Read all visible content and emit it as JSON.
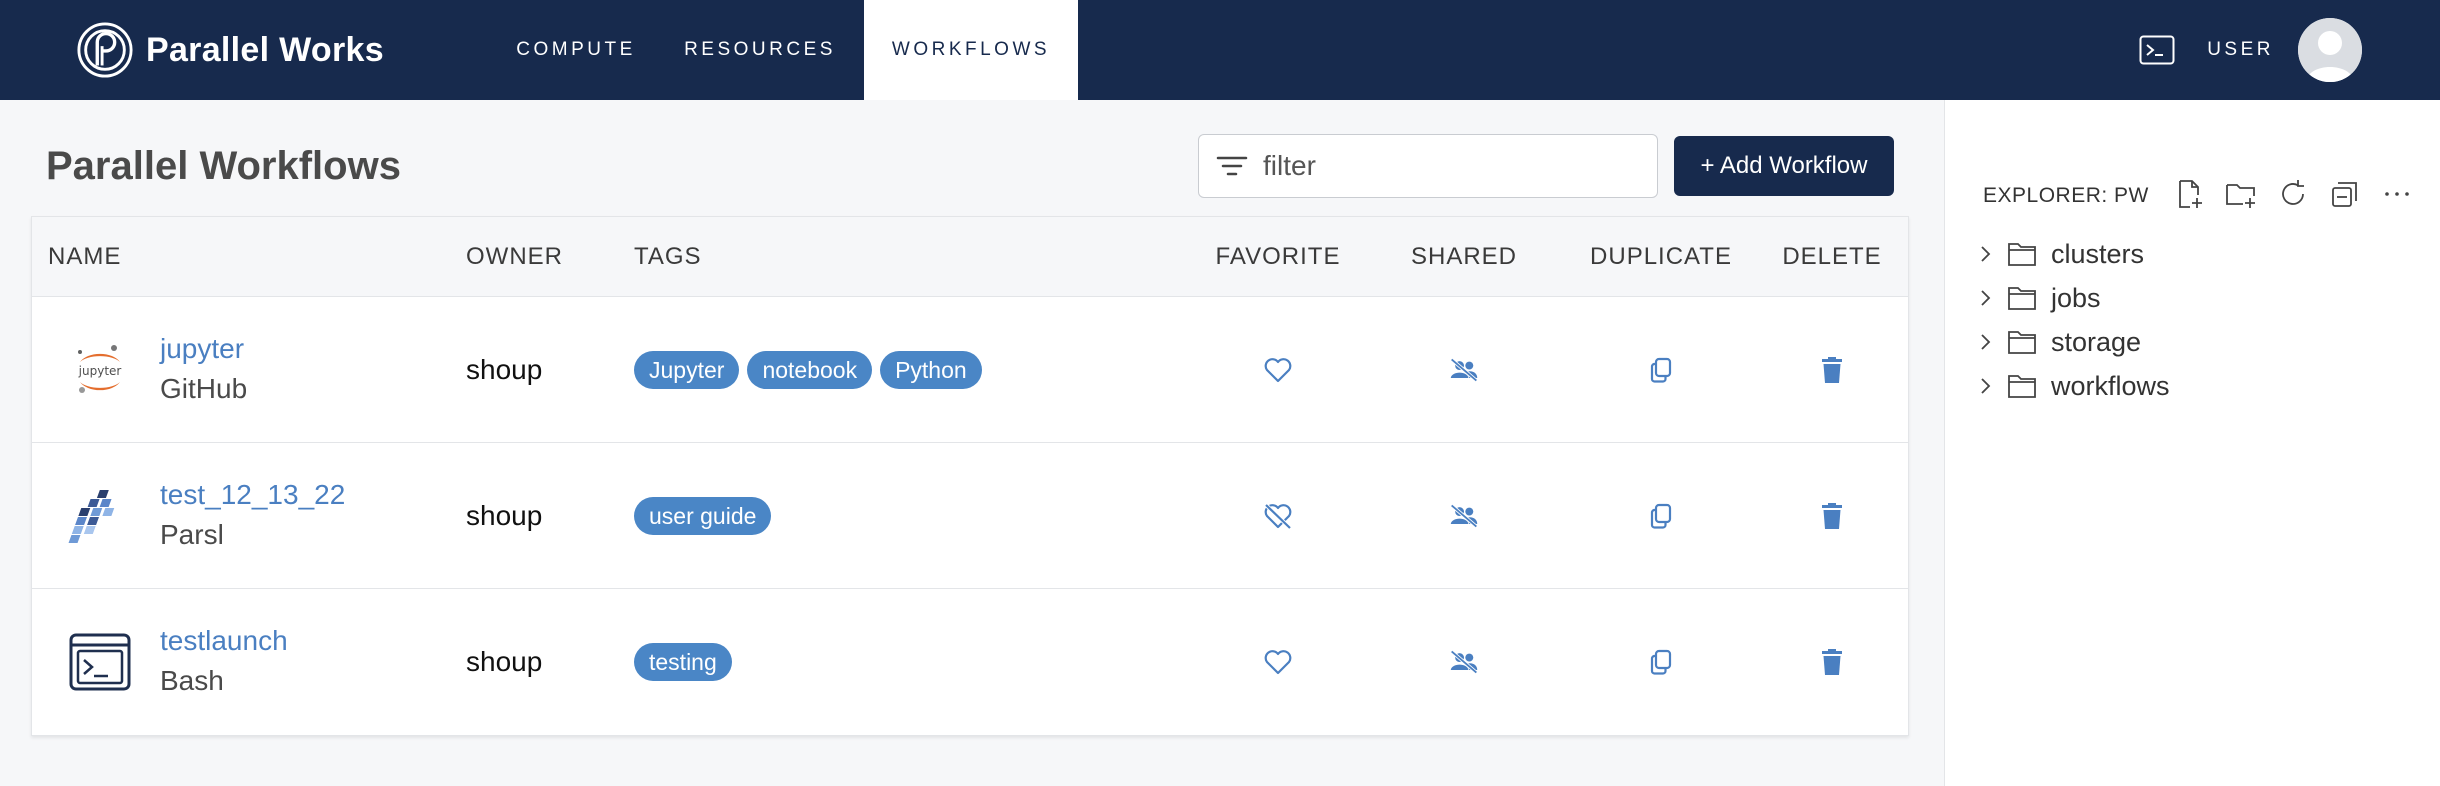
{
  "brand": {
    "name": "Parallel Works"
  },
  "nav": {
    "items": [
      {
        "label": "COMPUTE"
      },
      {
        "label": "RESOURCES"
      },
      {
        "label": "WORKFLOWS"
      }
    ],
    "user_label": "USER"
  },
  "page": {
    "title": "Parallel Workflows",
    "filter_placeholder": "filter",
    "add_button": "+ Add Workflow"
  },
  "table": {
    "columns": [
      "NAME",
      "OWNER",
      "TAGS",
      "FAVORITE",
      "SHARED",
      "DUPLICATE",
      "DELETE"
    ],
    "rows": [
      {
        "name": "jupyter",
        "source": "GitHub",
        "owner": "shoup",
        "tags": [
          "Jupyter",
          "notebook",
          "Python"
        ],
        "logo": "jupyter-logo",
        "favorite": "heart-icon"
      },
      {
        "name": "test_12_13_22",
        "source": "Parsl",
        "owner": "shoup",
        "tags": [
          "user guide"
        ],
        "logo": "parsl-logo",
        "favorite": "heart-off-icon"
      },
      {
        "name": "testlaunch",
        "source": "Bash",
        "owner": "shoup",
        "tags": [
          "testing"
        ],
        "logo": "bash-terminal-icon",
        "favorite": "heart-icon"
      }
    ]
  },
  "explorer": {
    "title": "EXPLORER: PW",
    "items": [
      {
        "label": "clusters"
      },
      {
        "label": "jobs"
      },
      {
        "label": "storage"
      },
      {
        "label": "workflows"
      }
    ]
  },
  "colors": {
    "navy": "#172a4d",
    "link_blue": "#4a7fc1",
    "tag_blue": "#4a86c6",
    "icon_blue": "#4a7fc1"
  }
}
